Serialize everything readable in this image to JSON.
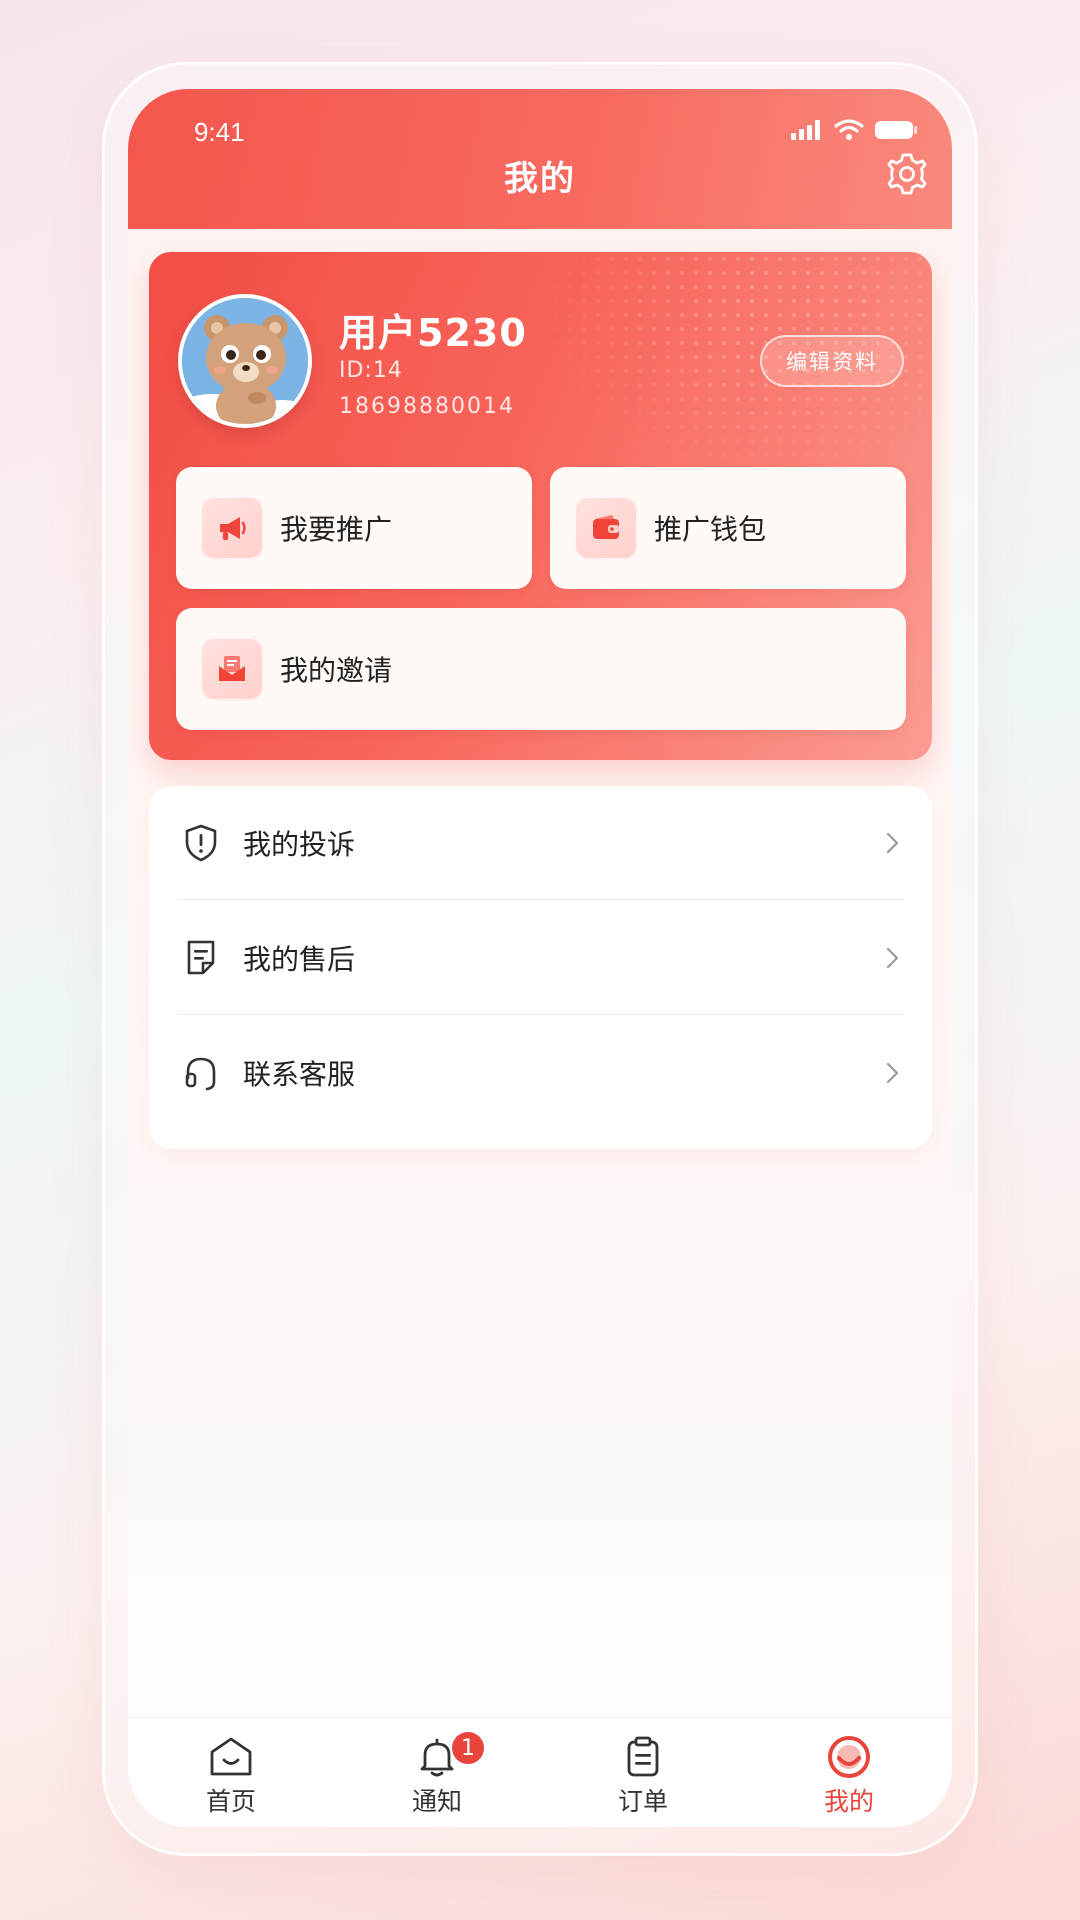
{
  "status_bar": {
    "time": "9:41"
  },
  "header": {
    "title": "我的"
  },
  "profile": {
    "username": "用户5230",
    "user_id": "ID:14",
    "phone": "18698880014",
    "edit_label": "编辑资料"
  },
  "actions": {
    "promote": {
      "label": "我要推广",
      "icon": "megaphone-icon"
    },
    "wallet": {
      "label": "推广钱包",
      "icon": "wallet-icon"
    },
    "invite": {
      "label": "我的邀请",
      "icon": "envelope-icon"
    }
  },
  "menu": {
    "items": [
      {
        "label": "我的投诉",
        "icon": "shield-alert-icon"
      },
      {
        "label": "我的售后",
        "icon": "receipt-icon"
      },
      {
        "label": "联系客服",
        "icon": "headset-icon"
      }
    ]
  },
  "tabbar": {
    "items": [
      {
        "label": "首页",
        "icon": "home-icon"
      },
      {
        "label": "通知",
        "icon": "bell-icon",
        "badge": "1"
      },
      {
        "label": "订单",
        "icon": "clipboard-icon"
      },
      {
        "label": "我的",
        "icon": "profile-icon",
        "active": true
      }
    ]
  },
  "colors": {
    "accent": "#e8453c",
    "header_start": "#f4564d",
    "header_end": "#fa8a7e"
  }
}
